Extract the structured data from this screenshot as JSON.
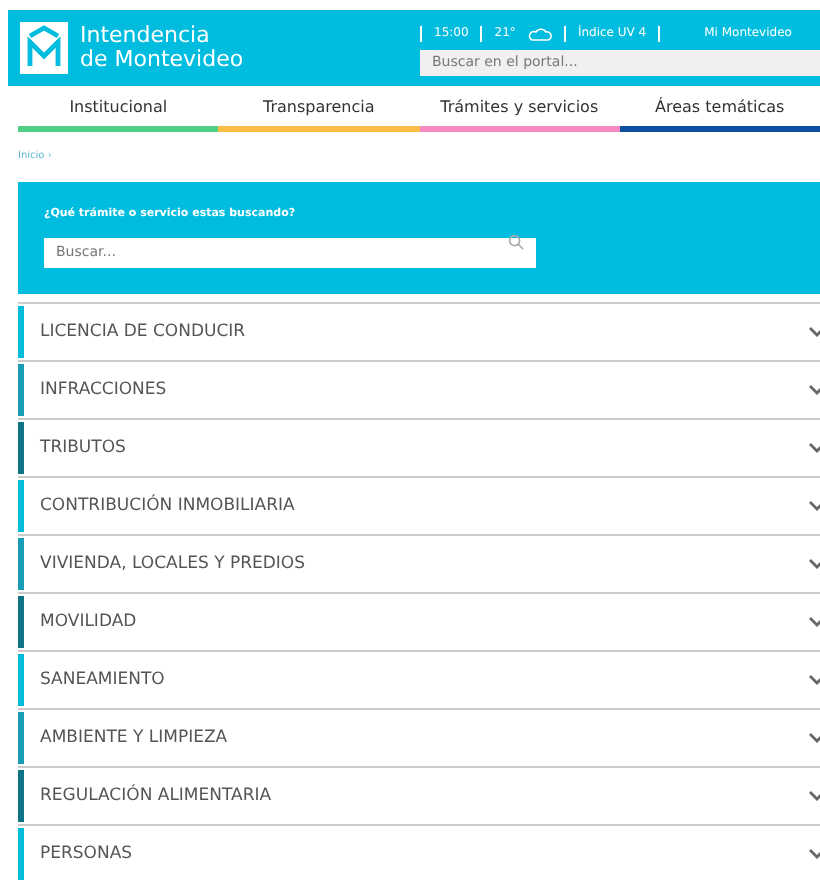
{
  "header": {
    "logo_line1": "Intendencia",
    "logo_line2": "de Montevideo",
    "time": "15:00",
    "temperature": "21°",
    "uv": "Índice UV 4",
    "account": "Mi Montevideo",
    "search": {
      "placeholder": "Buscar en el portal..."
    }
  },
  "nav": [
    {
      "label": "Institucional",
      "color": "#4fcf84"
    },
    {
      "label": "Transparencia",
      "color": "#fbbd43"
    },
    {
      "label": "Trámites y servicios",
      "color": "#f48ac0"
    },
    {
      "label": "Áreas temáticas",
      "color": "#0b4ea2"
    }
  ],
  "breadcrumb": "Inicio ›",
  "finder": {
    "title": "¿Qué trámite o servicio estas buscando?",
    "placeholder": "Buscar..."
  },
  "categories": [
    {
      "label": "LICENCIA DE CONDUCIR",
      "color": "#00bcd9",
      "expanded": false
    },
    {
      "label": "INFRACCIONES",
      "color": "#1a9db2",
      "expanded": false
    },
    {
      "label": "TRIBUTOS",
      "color": "#0e7383",
      "expanded": false
    },
    {
      "label": "CONTRIBUCIÓN INMOBILIARIA",
      "color": "#00bcd9",
      "expanded": false
    },
    {
      "label": "VIVIENDA, LOCALES Y PREDIOS",
      "color": "#1a9db2",
      "expanded": false
    },
    {
      "label": "MOVILIDAD",
      "color": "#0e7383",
      "expanded": false
    },
    {
      "label": "SANEAMIENTO",
      "color": "#00bcd9",
      "expanded": false
    },
    {
      "label": "AMBIENTE Y LIMPIEZA",
      "color": "#1a9db2",
      "expanded": false
    },
    {
      "label": "REGULACIÓN ALIMENTARIA",
      "color": "#0e7383",
      "expanded": false
    },
    {
      "label": "PERSONAS",
      "color": "#00bcd9",
      "expanded": false
    }
  ]
}
